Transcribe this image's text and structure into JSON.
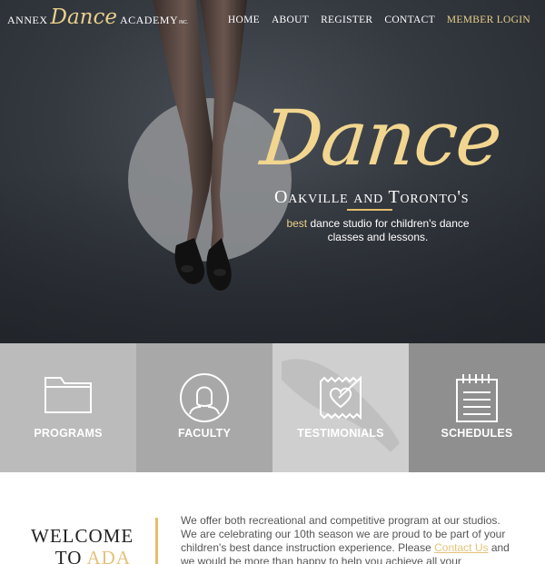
{
  "brand": {
    "word1": "ANNEX",
    "word2": "Dance",
    "word3": "ACADEMY",
    "mark": "INC."
  },
  "nav": {
    "items": [
      "HOME",
      "ABOUT",
      "REGISTER",
      "CONTACT"
    ],
    "login": "MEMBER LOGIN"
  },
  "hero": {
    "title": "Dance",
    "subtitle": "Oakville and Toronto's",
    "tagline_highlight": "best",
    "tagline_rest": " dance studio for children's dance classes and lessons."
  },
  "tiles": [
    {
      "label": "PROGRAMS",
      "icon": "folder-icon"
    },
    {
      "label": "FACULTY",
      "icon": "person-icon"
    },
    {
      "label": "TESTIMONIALS",
      "icon": "heart-stamp-icon"
    },
    {
      "label": "SCHEDULES",
      "icon": "notepad-icon"
    }
  ],
  "welcome": {
    "heading_line1": "WELCOME",
    "heading_to": "TO ",
    "heading_ada": "ADA",
    "text_before": "We offer both recreational and competitive program at our studios. We are celebrating our  10th season we are proud to be part of your children's best dance instruction experience.  Please ",
    "link": "Contact Us",
    "text_after": " and we would be more than happy to help you achieve all your"
  },
  "colors": {
    "gold": "#e9cf8a",
    "accent_rule": "#e2be6c",
    "hero_bg": "#343940"
  }
}
